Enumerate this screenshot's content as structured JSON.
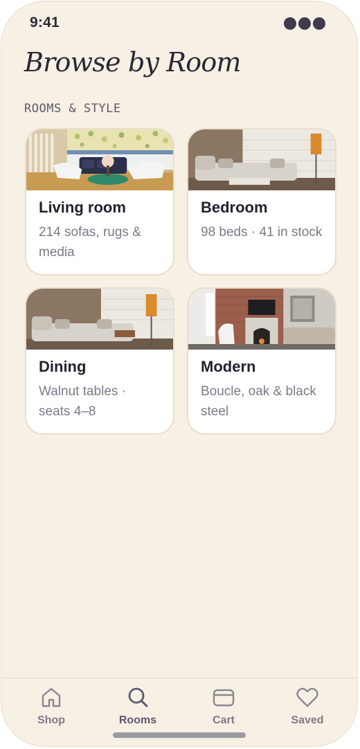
{
  "status": {
    "time": "9:41"
  },
  "header": {
    "title": "Browse by Room",
    "section_label": "ROOMS & STYLE"
  },
  "rooms": [
    {
      "title": "Living room",
      "subtitle": "214 sofas, rugs & media"
    },
    {
      "title": "Bedroom",
      "subtitle": "98 beds · 41 in stock"
    },
    {
      "title": "Dining",
      "subtitle": "Walnut tables · seats 4–8"
    },
    {
      "title": "Modern",
      "subtitle": "Boucle, oak & black steel"
    }
  ],
  "tabs": [
    {
      "label": "Shop",
      "icon": "home-icon",
      "active": false
    },
    {
      "label": "Rooms",
      "icon": "search-icon",
      "active": true
    },
    {
      "label": "Cart",
      "icon": "wallet-icon",
      "active": false
    },
    {
      "label": "Saved",
      "icon": "heart-icon",
      "active": false
    }
  ],
  "colors": {
    "background": "#f7f0e4",
    "card": "#ffffff",
    "text_primary": "#24212d",
    "text_secondary": "#7d7887",
    "active_tab": "#5c5872"
  }
}
